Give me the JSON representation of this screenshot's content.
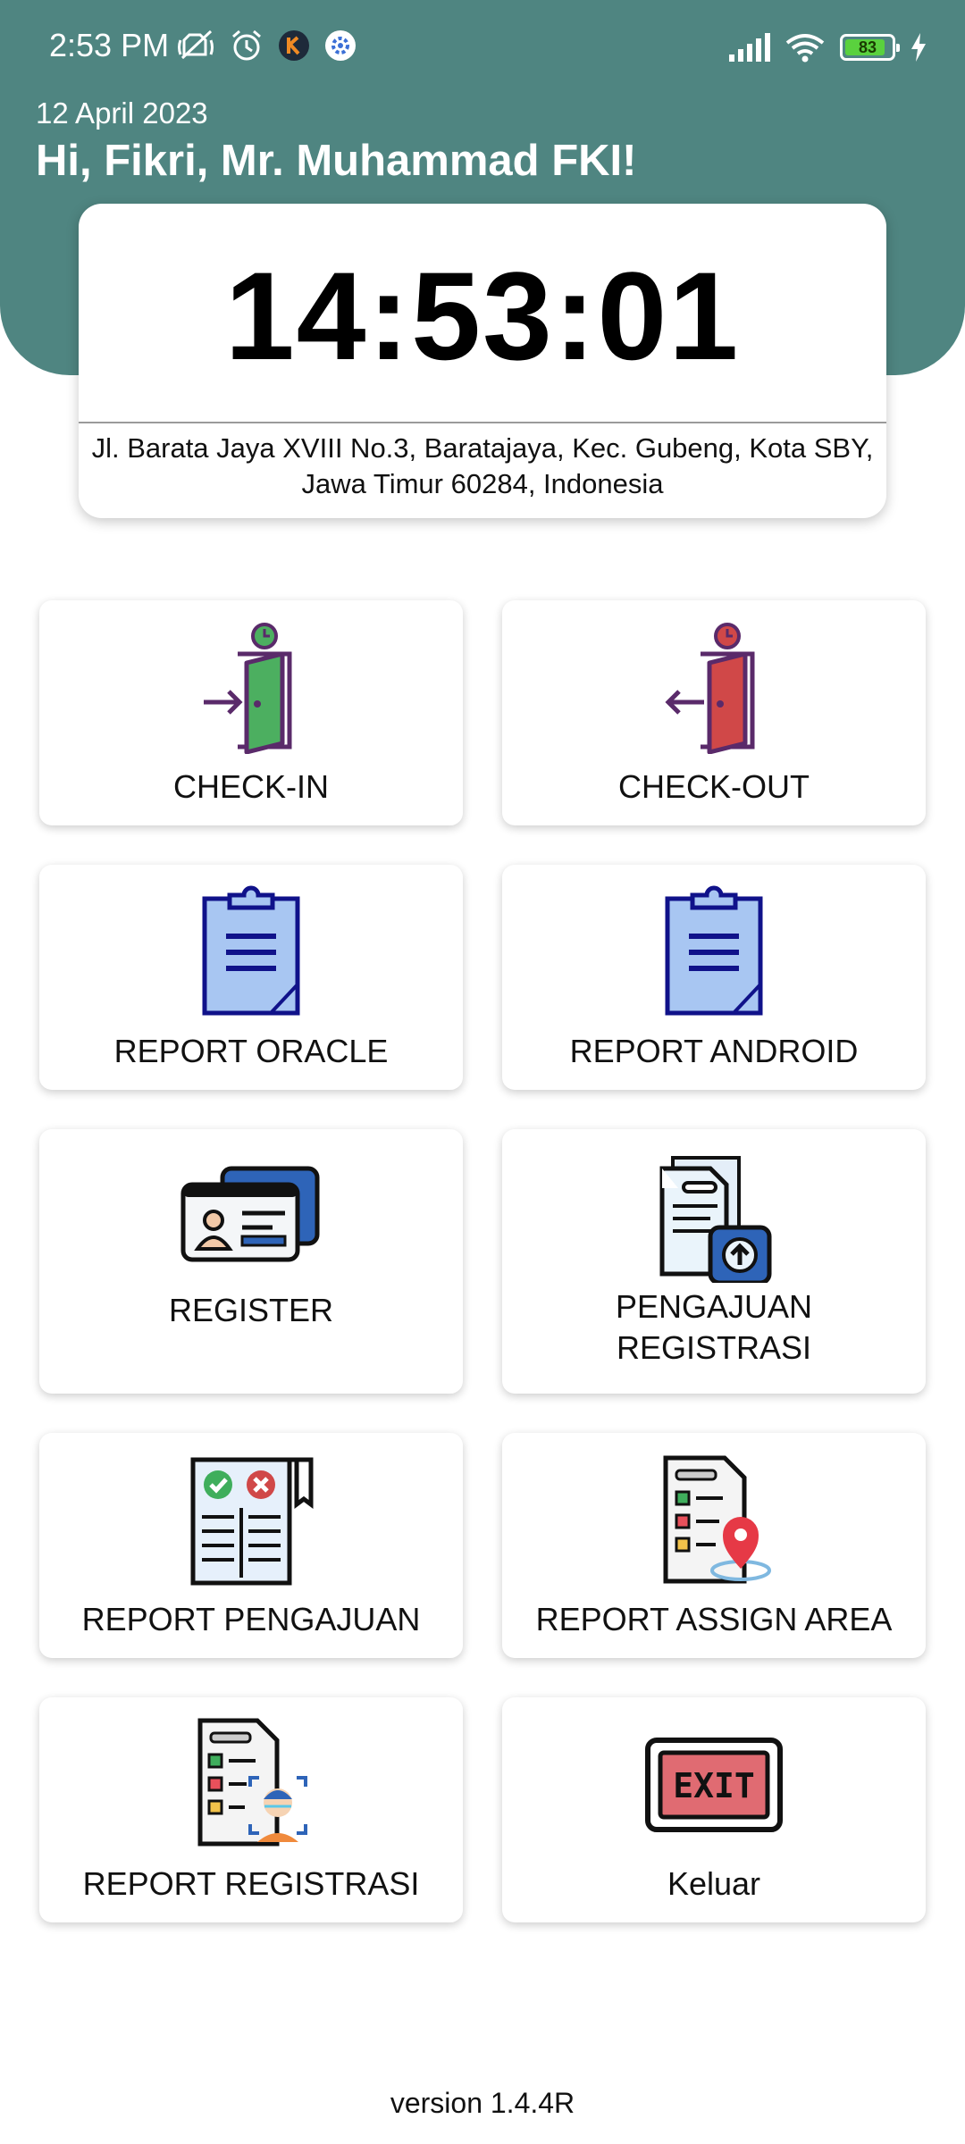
{
  "status_bar": {
    "time": "2:53 PM",
    "battery": "83",
    "icons_left": [
      "mute-icon",
      "alarm-icon",
      "app-k-icon",
      "app-gear-icon"
    ],
    "icons_right": [
      "signal-icon",
      "wifi-icon",
      "battery-icon",
      "charging-icon"
    ]
  },
  "header": {
    "date": "12 April 2023",
    "greeting": "Hi, Fikri, Mr. Muhammad FKI!",
    "color": "#4f8581"
  },
  "clock_card": {
    "time": "14:53:01",
    "address_line1": "Jl. Barata Jaya XVIII No.3, Baratajaya, Kec. Gubeng, Kota SBY,",
    "address_line2": "Jawa Timur 60284, Indonesia"
  },
  "menu": {
    "check_in": {
      "label": "CHECK-IN",
      "icon": "door-enter-icon",
      "accent": "#4caf60"
    },
    "check_out": {
      "label": "CHECK-OUT",
      "icon": "door-exit-icon",
      "accent": "#d04848"
    },
    "report_oracle": {
      "label": "REPORT ORACLE",
      "icon": "clipboard-icon"
    },
    "report_android": {
      "label": "REPORT ANDROID",
      "icon": "clipboard-icon"
    },
    "register": {
      "label": "REGISTER",
      "icon": "id-card-icon"
    },
    "pengajuan_registrasi": {
      "label_line1": "PENGAJUAN",
      "label_line2": "REGISTRASI",
      "icon": "document-upload-icon"
    },
    "report_pengajuan": {
      "label": "REPORT PENGAJUAN",
      "icon": "approval-list-icon"
    },
    "report_assign_area": {
      "label": "REPORT ASSIGN AREA",
      "icon": "checklist-location-icon"
    },
    "report_registrasi": {
      "label": "REPORT REGISTRASI",
      "icon": "face-scan-document-icon"
    },
    "keluar": {
      "label": "Keluar",
      "icon": "exit-sign-icon"
    }
  },
  "footer": {
    "version": "version 1.4.4R"
  }
}
